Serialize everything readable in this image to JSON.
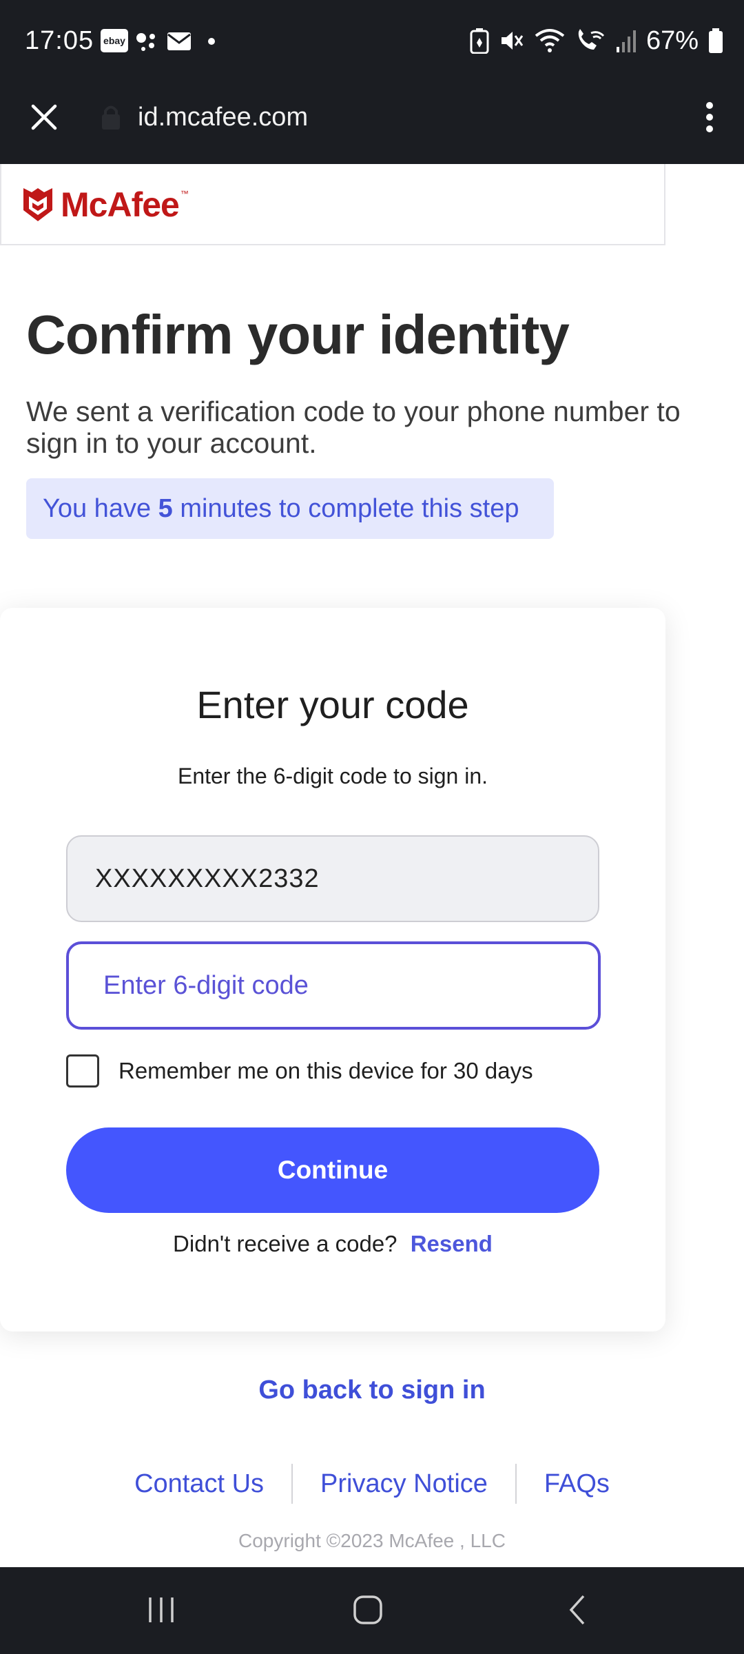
{
  "status_bar": {
    "time": "17:05",
    "ebay_badge": "ebay",
    "battery_percent": "67%",
    "icons": [
      "ebay-icon",
      "assistant-icon",
      "mail-icon",
      "notification-dot-icon",
      "battery-saver-icon",
      "mute-icon",
      "wifi-icon",
      "wifi-calling-icon",
      "signal-icon",
      "battery-icon"
    ]
  },
  "browser": {
    "url": "id.mcafee.com"
  },
  "brand": {
    "name": "McAfee",
    "trademark": "™",
    "color": "#c01818"
  },
  "main": {
    "title": "Confirm your identity",
    "subtitle": "We sent a verification code to your phone number to sign in to your account.",
    "timer_prefix": "You have ",
    "timer_minutes": "5",
    "timer_suffix": " minutes to complete this step"
  },
  "card": {
    "title": "Enter your code",
    "instruction": "Enter the 6-digit code to sign in.",
    "phone_value": "XXXXXXXXX2332",
    "code_placeholder": "Enter 6-digit code",
    "remember_label": "Remember me on this device for 30 days",
    "continue_label": "Continue",
    "resend_prompt": "Didn't receive a code?",
    "resend_label": "Resend"
  },
  "back_to_sign_in": "Go back to sign in",
  "footer": {
    "links": [
      "Contact Us",
      "Privacy Notice",
      "FAQs"
    ],
    "copyright": "Copyright ©2023 McAfee , LLC"
  },
  "colors": {
    "accent": "#4456fe",
    "link": "#3f4fd8",
    "banner_bg": "#e5e8fd",
    "dark_bar": "#1b1d22"
  }
}
